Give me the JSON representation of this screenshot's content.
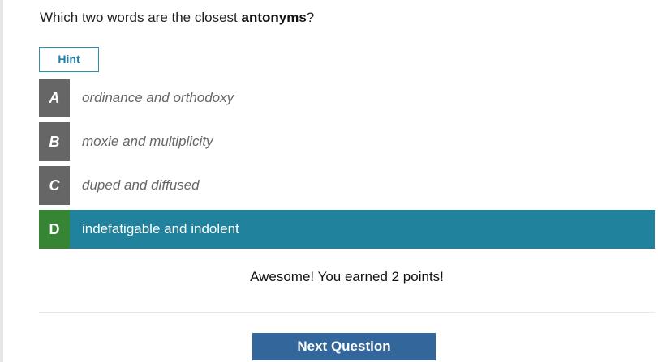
{
  "question": {
    "prefix": "Which two words are the closest ",
    "emphasis": "antonyms",
    "suffix": "?"
  },
  "hint_label": "Hint",
  "choices": [
    {
      "letter": "A",
      "text": "ordinance and orthodoxy"
    },
    {
      "letter": "B",
      "text": "moxie and multiplicity"
    },
    {
      "letter": "C",
      "text": "duped and diffused"
    },
    {
      "letter": "D",
      "text": "indefatigable and indolent"
    }
  ],
  "selected_choice": "D",
  "feedback": "Awesome! You earned 2 points!",
  "next_label": "Next Question",
  "colors": {
    "selected_row": "#21829e",
    "selected_letter": "#358535",
    "unselected_letter": "#666666",
    "next_button": "#33669a",
    "hint_border": "#2b8fb0"
  }
}
